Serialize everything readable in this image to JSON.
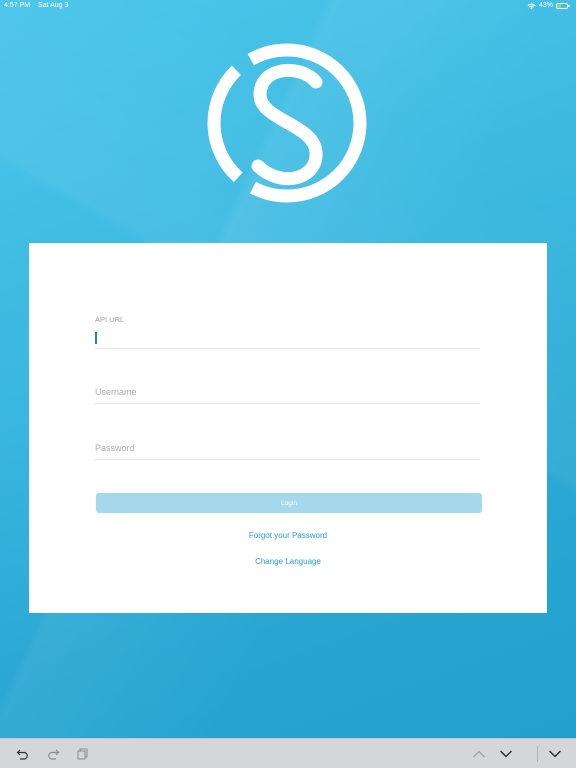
{
  "status_bar": {
    "time": "4:57 PM",
    "date": "Sat Aug 3",
    "battery": "43%",
    "battery_level": 0.43,
    "wifi_icon": "wifi-icon",
    "battery_icon": "battery-icon"
  },
  "form": {
    "api_url": {
      "label": "API URL",
      "value": ""
    },
    "username": {
      "placeholder": "Username",
      "value": ""
    },
    "password": {
      "placeholder": "Password",
      "value": ""
    },
    "login_label": "Login",
    "forgot_password": "Forgot your Password",
    "change_language": "Change Language"
  },
  "toolbar": {
    "left": [
      "undo-icon",
      "redo-icon",
      "clipboard-icon"
    ],
    "right": [
      "chevron-up-icon",
      "chevron-down-icon",
      "dismiss-keyboard-icon"
    ]
  },
  "colors": {
    "background": "#3ab8e0",
    "accent": "#2a9fd0",
    "login_button": "#a6d8ec",
    "cursor": "#2b78e4"
  }
}
